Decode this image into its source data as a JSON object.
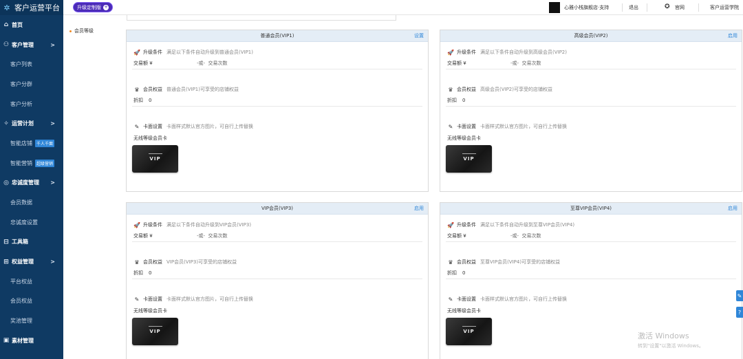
{
  "brand": {
    "title": "客户运营平台"
  },
  "topbar": {
    "upgrade_label": "升级定制版",
    "store_name": "心雅小栈旗舰店·支持",
    "logout": "退出",
    "home": "官网",
    "academy": "客户运营学院"
  },
  "sidebar": {
    "items": [
      {
        "label": "首页",
        "type": "main",
        "icon": "home-icon"
      },
      {
        "label": "客户管理",
        "type": "main",
        "icon": "users-icon",
        "chevron": ">"
      },
      {
        "label": "客户列表",
        "type": "sub"
      },
      {
        "label": "客户分群",
        "type": "sub"
      },
      {
        "label": "客户分析",
        "type": "sub"
      },
      {
        "label": "运营计划",
        "type": "main",
        "icon": "compass-icon",
        "chevron": ">"
      },
      {
        "label": "智能店铺",
        "type": "sub",
        "tag": "千人千面"
      },
      {
        "label": "智能营销",
        "type": "sub",
        "tag": "超级营销"
      },
      {
        "label": "忠诚度管理",
        "type": "main",
        "icon": "target-icon",
        "chevron": ">"
      },
      {
        "label": "会员数据",
        "type": "sub"
      },
      {
        "label": "忠诚度设置",
        "type": "sub"
      },
      {
        "label": "工具箱",
        "type": "main",
        "icon": "toolbox-icon"
      },
      {
        "label": "权益管理",
        "type": "main",
        "icon": "gift-icon",
        "chevron": ">"
      },
      {
        "label": "平台权益",
        "type": "sub"
      },
      {
        "label": "会员权益",
        "type": "sub"
      },
      {
        "label": "奖池管理",
        "type": "sub"
      },
      {
        "label": "素材管理",
        "type": "main",
        "icon": "image-icon"
      }
    ]
  },
  "inner_menu": {
    "item": "会员等级"
  },
  "cards": [
    {
      "title": "普通会员(VIP1)",
      "action": "设置",
      "upgrade_label": "升级条件",
      "upgrade_desc": "满足以下条件自动升级到普通会员(VIP1)",
      "amount_label": "交易额 ¥",
      "or_text": "-或-",
      "count_label": "交易次数",
      "rights_label": "会员权益",
      "rights_desc": "普通会员(VIP1)可享受的店铺权益",
      "discount_label": "折扣",
      "discount_value": "0",
      "card_label": "卡面设置",
      "card_desc": "卡面样式默认官方图片，可自行上传替换",
      "card_name": "无线等级会员卡",
      "vip_text": "VIP"
    },
    {
      "title": "高级会员(VIP2)",
      "action": "启用",
      "upgrade_label": "升级条件",
      "upgrade_desc": "满足以下条件自动升级到高级会员(VIP2)",
      "amount_label": "交易额 ¥",
      "or_text": "-或-",
      "count_label": "交易次数",
      "rights_label": "会员权益",
      "rights_desc": "高级会员(VIP2)可享受的店铺权益",
      "discount_label": "折扣",
      "discount_value": "0",
      "card_label": "卡面设置",
      "card_desc": "卡面样式默认官方图片，可自行上传替换",
      "card_name": "无线等级会员卡",
      "vip_text": "VIP"
    },
    {
      "title": "VIP会员(VIP3)",
      "action": "启用",
      "upgrade_label": "升级条件",
      "upgrade_desc": "满足以下条件自动升级到VIP会员(VIP3)",
      "amount_label": "交易额 ¥",
      "or_text": "-或-",
      "count_label": "交易次数",
      "rights_label": "会员权益",
      "rights_desc": "VIP会员(VIP3)可享受的店铺权益",
      "discount_label": "折扣",
      "discount_value": "0",
      "card_label": "卡面设置",
      "card_desc": "卡面样式默认官方图片，可自行上传替换",
      "card_name": "无线等级会员卡",
      "vip_text": "VIP"
    },
    {
      "title": "至尊VIP会员(VIP4)",
      "action": "启用",
      "upgrade_label": "升级条件",
      "upgrade_desc": "满足以下条件自动升级到至尊VIP会员(VIP4)",
      "amount_label": "交易额 ¥",
      "or_text": "-或-",
      "count_label": "交易次数",
      "rights_label": "会员权益",
      "rights_desc": "至尊VIP会员(VIP4)可享受的店铺权益",
      "discount_label": "折扣",
      "discount_value": "0",
      "card_label": "卡面设置",
      "card_desc": "卡面样式默认官方图片，可自行上传替换",
      "card_name": "无线等级会员卡",
      "vip_text": "VIP"
    }
  ],
  "watermark": {
    "line1": "激活 Windows",
    "line2": "转到\"设置\"以激活 Windows。"
  }
}
